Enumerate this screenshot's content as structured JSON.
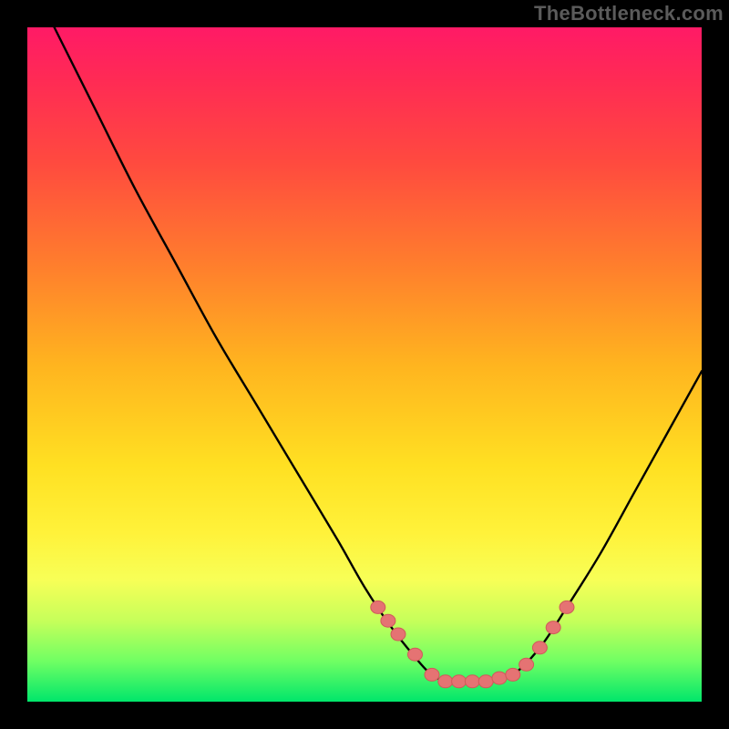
{
  "attribution": "TheBottleneck.com",
  "colors": {
    "background": "#000000",
    "gradient_top": "#ff1a66",
    "gradient_mid": "#ffd020",
    "gradient_bottom": "#00e66b",
    "curve": "#000000",
    "marker_fill": "#e57373",
    "marker_stroke": "#d05a5a"
  },
  "chart_data": {
    "type": "line",
    "title": "",
    "xlabel": "",
    "ylabel": "",
    "xlim": [
      0,
      100
    ],
    "ylim": [
      0,
      100
    ],
    "grid": false,
    "legend": false,
    "series": [
      {
        "name": "bottleneck-curve",
        "x": [
          4,
          10,
          16,
          22,
          28,
          34,
          40,
          46,
          50,
          54,
          58,
          60,
          62,
          64,
          68,
          72,
          76,
          80,
          85,
          90,
          95,
          100
        ],
        "values": [
          100,
          88,
          76,
          65,
          54,
          44,
          34,
          24,
          17,
          11,
          6,
          4,
          3,
          3,
          3,
          4,
          8,
          14,
          22,
          31,
          40,
          49
        ]
      }
    ],
    "markers": {
      "name": "highlighted-points",
      "x": [
        52,
        53.5,
        55,
        57.5,
        60,
        62,
        64,
        66,
        68,
        70,
        72,
        74,
        76,
        78,
        80
      ],
      "values": [
        14,
        12,
        10,
        7,
        4,
        3,
        3,
        3,
        3,
        3.5,
        4,
        5.5,
        8,
        11,
        14
      ]
    }
  }
}
